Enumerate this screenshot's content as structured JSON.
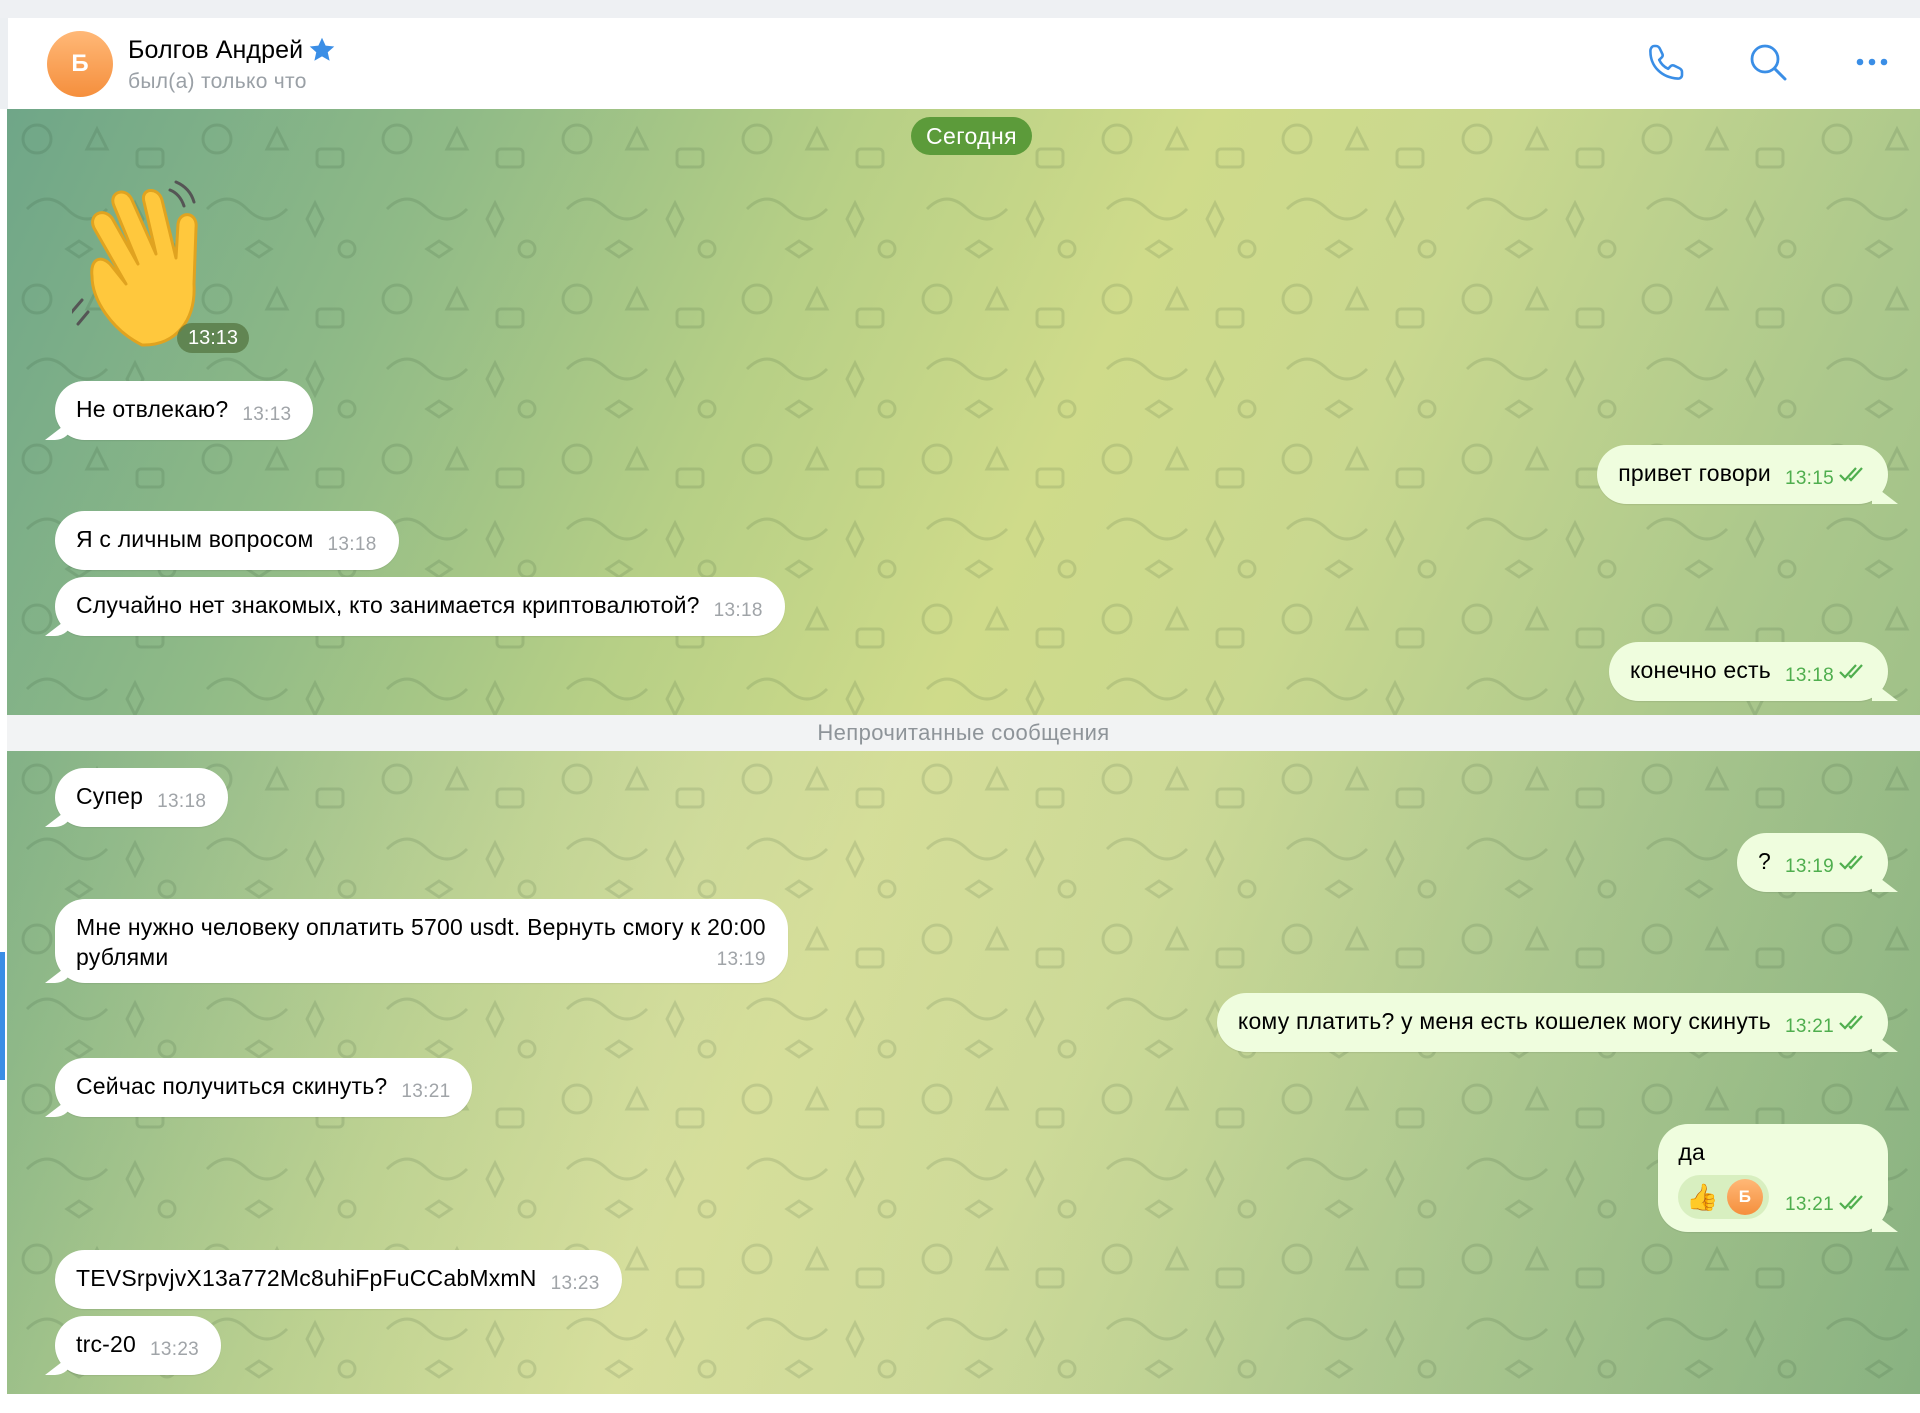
{
  "header": {
    "avatar_letter": "Б",
    "name": "Болгов Андрей",
    "status": "был(а) только что"
  },
  "icons": {
    "verified": "star-icon",
    "call": "phone-icon",
    "search": "search-icon",
    "menu": "more-icon",
    "read": "double-check-icon"
  },
  "colors": {
    "accent": "#3a8ee6",
    "outgoing_bubble": "#effdde",
    "incoming_bubble": "#ffffff",
    "date_pill": "#5c9b3a",
    "read_time": "#4fae4e",
    "avatar": "#f58f3d"
  },
  "chat": {
    "date_label": "Сегодня",
    "sticker": {
      "emoji": "👋",
      "time": "13:13"
    },
    "unread_separator": "Непрочитанные сообщения",
    "messages": [
      {
        "dir": "in",
        "text": "Не отвлекаю?",
        "time": "13:13"
      },
      {
        "dir": "out",
        "text": "привет говори",
        "time": "13:15"
      },
      {
        "dir": "in",
        "text": "Я с личным вопросом",
        "time": "13:18"
      },
      {
        "dir": "in",
        "text": "Случайно нет знакомых, кто занимается криптовалютой?",
        "time": "13:18"
      },
      {
        "dir": "out",
        "text": "конечно есть",
        "time": "13:18"
      },
      {
        "dir": "in",
        "text": "Супер",
        "time": "13:18"
      },
      {
        "dir": "out",
        "text": "?",
        "time": "13:19"
      },
      {
        "dir": "in",
        "text": "Мне нужно человеку оплатить 5700 usdt. Вернуть смогу к 20:00",
        "text2": "рублями",
        "time": "13:19"
      },
      {
        "dir": "out",
        "text": "кому платить? у меня есть кошелек могу скинуть",
        "time": "13:21"
      },
      {
        "dir": "in",
        "text": "Сейчас получиться скинуть?",
        "time": "13:21"
      },
      {
        "dir": "out",
        "text": "да",
        "time": "13:21",
        "reaction": {
          "emoji": "👍",
          "avatar_letter": "Б"
        }
      },
      {
        "dir": "in",
        "text": "TEVSrpvjvX13a772Mc8uhiFpFuCCabMxmN",
        "time": "13:23"
      },
      {
        "dir": "in",
        "text": "trc-20",
        "time": "13:23"
      }
    ]
  }
}
